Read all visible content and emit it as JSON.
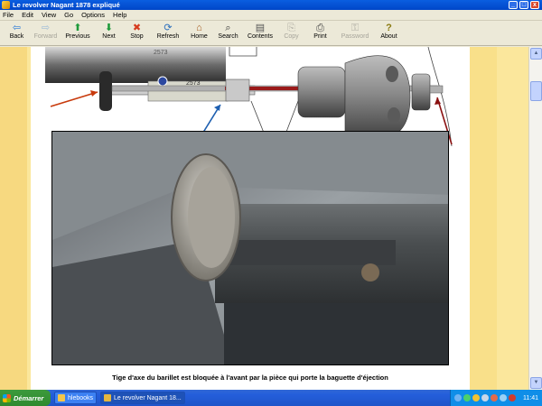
{
  "window": {
    "title": "Le revolver Nagant 1878 expliqué",
    "controls": {
      "minimize": "_",
      "maximize": "□",
      "close": "x"
    }
  },
  "menu": [
    "File",
    "Edit",
    "View",
    "Go",
    "Options",
    "Help"
  ],
  "toolbar": [
    {
      "label": "Back",
      "icon": "back-arrow-icon",
      "glyph": "⇦",
      "enabled": true
    },
    {
      "label": "Forward",
      "icon": "forward-arrow-icon",
      "glyph": "⇨",
      "enabled": false
    },
    {
      "label": "Previous",
      "icon": "up-arrow-icon",
      "glyph": "⬆",
      "enabled": true
    },
    {
      "label": "Next",
      "icon": "down-arrow-icon",
      "glyph": "⬇",
      "enabled": true
    },
    {
      "label": "Stop",
      "icon": "stop-icon",
      "glyph": "✖",
      "enabled": true
    },
    {
      "label": "Refresh",
      "icon": "refresh-icon",
      "glyph": "⟳",
      "enabled": true
    },
    {
      "label": "Home",
      "icon": "home-icon",
      "glyph": "⌂",
      "enabled": true
    },
    {
      "label": "Search",
      "icon": "search-icon",
      "glyph": "⌕",
      "enabled": true
    },
    {
      "label": "Contents",
      "icon": "contents-icon",
      "glyph": "▤",
      "enabled": true
    },
    {
      "label": "Copy",
      "icon": "copy-icon",
      "glyph": "⎘",
      "enabled": false
    },
    {
      "label": "Print",
      "icon": "print-icon",
      "glyph": "⎙",
      "enabled": true
    },
    {
      "label": "Password",
      "icon": "key-icon",
      "glyph": "⚿",
      "enabled": false
    },
    {
      "label": "About",
      "icon": "question-icon",
      "glyph": "?",
      "enabled": true
    }
  ],
  "document": {
    "drawing_serial": "2573",
    "caption": "Tige d'axe du barillet est bloquée à l'avant par la pièce qui porte la baguette d'éjection"
  },
  "taskbar": {
    "start_label": "Démarrer",
    "tasks": [
      {
        "label": "hlebooks",
        "active": false
      },
      {
        "label": "Le revolver Nagant 18...",
        "active": true
      }
    ],
    "clock": "11:41"
  },
  "colors": {
    "page_bg": "#fbe79c",
    "titlebar": "#0a5ee0",
    "taskbar": "#245edb",
    "start": "#2f8a2f"
  }
}
